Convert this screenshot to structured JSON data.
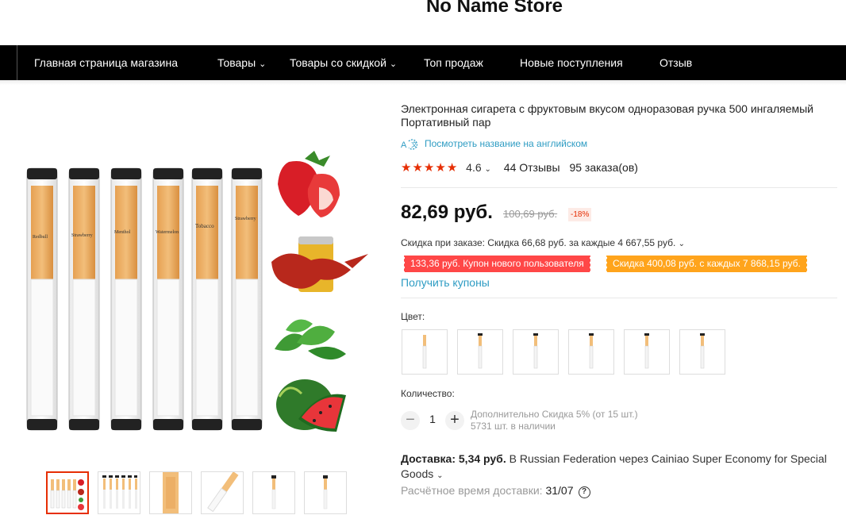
{
  "store": {
    "name": "No Name Store"
  },
  "nav": {
    "items": [
      {
        "label": "Главная страница магазина",
        "has_dropdown": false
      },
      {
        "label": "Товары",
        "has_dropdown": true
      },
      {
        "label": "Товары со скидкой",
        "has_dropdown": true
      },
      {
        "label": "Топ продаж",
        "has_dropdown": false
      },
      {
        "label": "Новые поступления",
        "has_dropdown": false
      },
      {
        "label": "Отзыв",
        "has_dropdown": false
      }
    ],
    "chevron": "⌄"
  },
  "gallery": {
    "main_image_icon": "cigarette-flavors-image",
    "image_labels": [
      "Redbull",
      "Strawberry",
      "Menthol",
      "Watermelon",
      "Tobacco",
      "Strawberry"
    ],
    "thumbnail_count": 6,
    "active_thumbnail": 0
  },
  "product": {
    "title": "Электронная сигарета с фруктовым вкусом одноразовая ручка 500 ингаляемый Портативный пар",
    "translate_link": "Посмотреть название на английском",
    "rating": {
      "stars": 5,
      "value": "4.6",
      "reviews": "44 Отзывы",
      "orders": "95 заказа(ов)"
    },
    "price": "82,69 руб.",
    "old_price": "100,69 руб.",
    "discount": "-18%",
    "order_discount": "Скидка при заказе: Скидка 66,68 руб. за каждые 4 667,55 руб.",
    "coupons": [
      "133,36 руб. Купон нового пользователя",
      "Скидка 400,08 руб. с каждых 7 868,15 руб."
    ],
    "get_coupons": "Получить купоны",
    "color_label": "Цвет:",
    "color_count": 6,
    "quantity_label": "Количество:",
    "quantity": "1",
    "quantity_discount": "Дополнительно Скидка 5% (от 15 шт.)",
    "stock": "5731 шт. в наличии",
    "shipping_prefix": "Доставка: 5,34 руб.",
    "shipping_text": "B Russian Federation через Cainiao Super Economy for Special Goods",
    "delivery_label": "Расчётное время доставки:",
    "delivery_date": "31/07"
  },
  "colors": {
    "accent": "#e62e04",
    "link": "#2e9cc3",
    "coupon_red": "#ff4747",
    "coupon_orange": "#ffa41c",
    "nav_bg": "#000000"
  }
}
